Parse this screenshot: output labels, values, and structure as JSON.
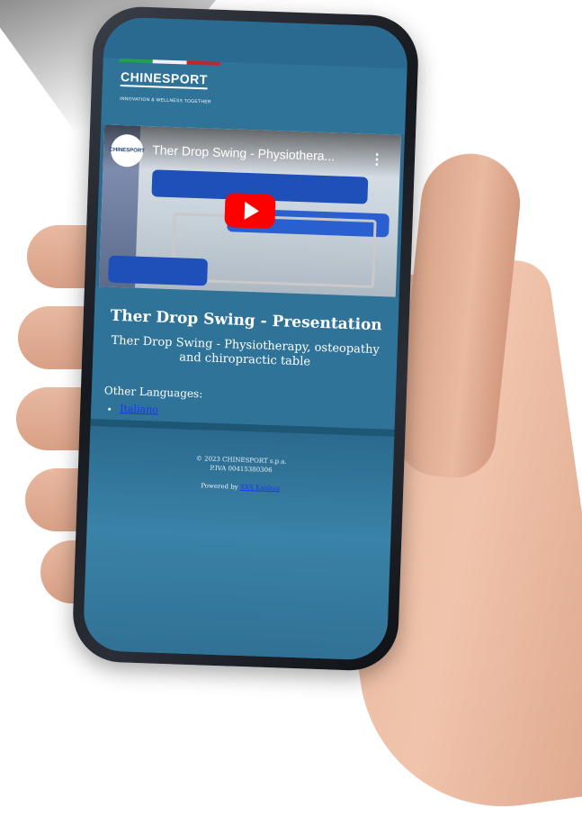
{
  "header": {
    "logo_text": "CHINESPORT",
    "logo_tagline": "INNOVATION & WELLNESS TOGETHER"
  },
  "video": {
    "channel_badge": "CHINESPORT",
    "title": "Ther Drop Swing - Physiothera...",
    "menu_glyph": "⋮"
  },
  "main": {
    "title": "Ther Drop Swing - Presentation",
    "subtitle": "Ther Drop Swing - Physiotherapy, osteopathy and chiropractic table",
    "other_languages_heading": "Other Languages:",
    "languages": [
      "Italiano"
    ]
  },
  "footer": {
    "copyright": "© 2023 CHINESPORT s.p.a.",
    "vat": "P.IVA 00415380306",
    "powered_by_prefix": "Powered by",
    "powered_by_link": "XXX Kanban"
  },
  "colors": {
    "page_bg": "#2f7399",
    "link": "#1a33ff",
    "youtube_red": "#ff0000"
  }
}
